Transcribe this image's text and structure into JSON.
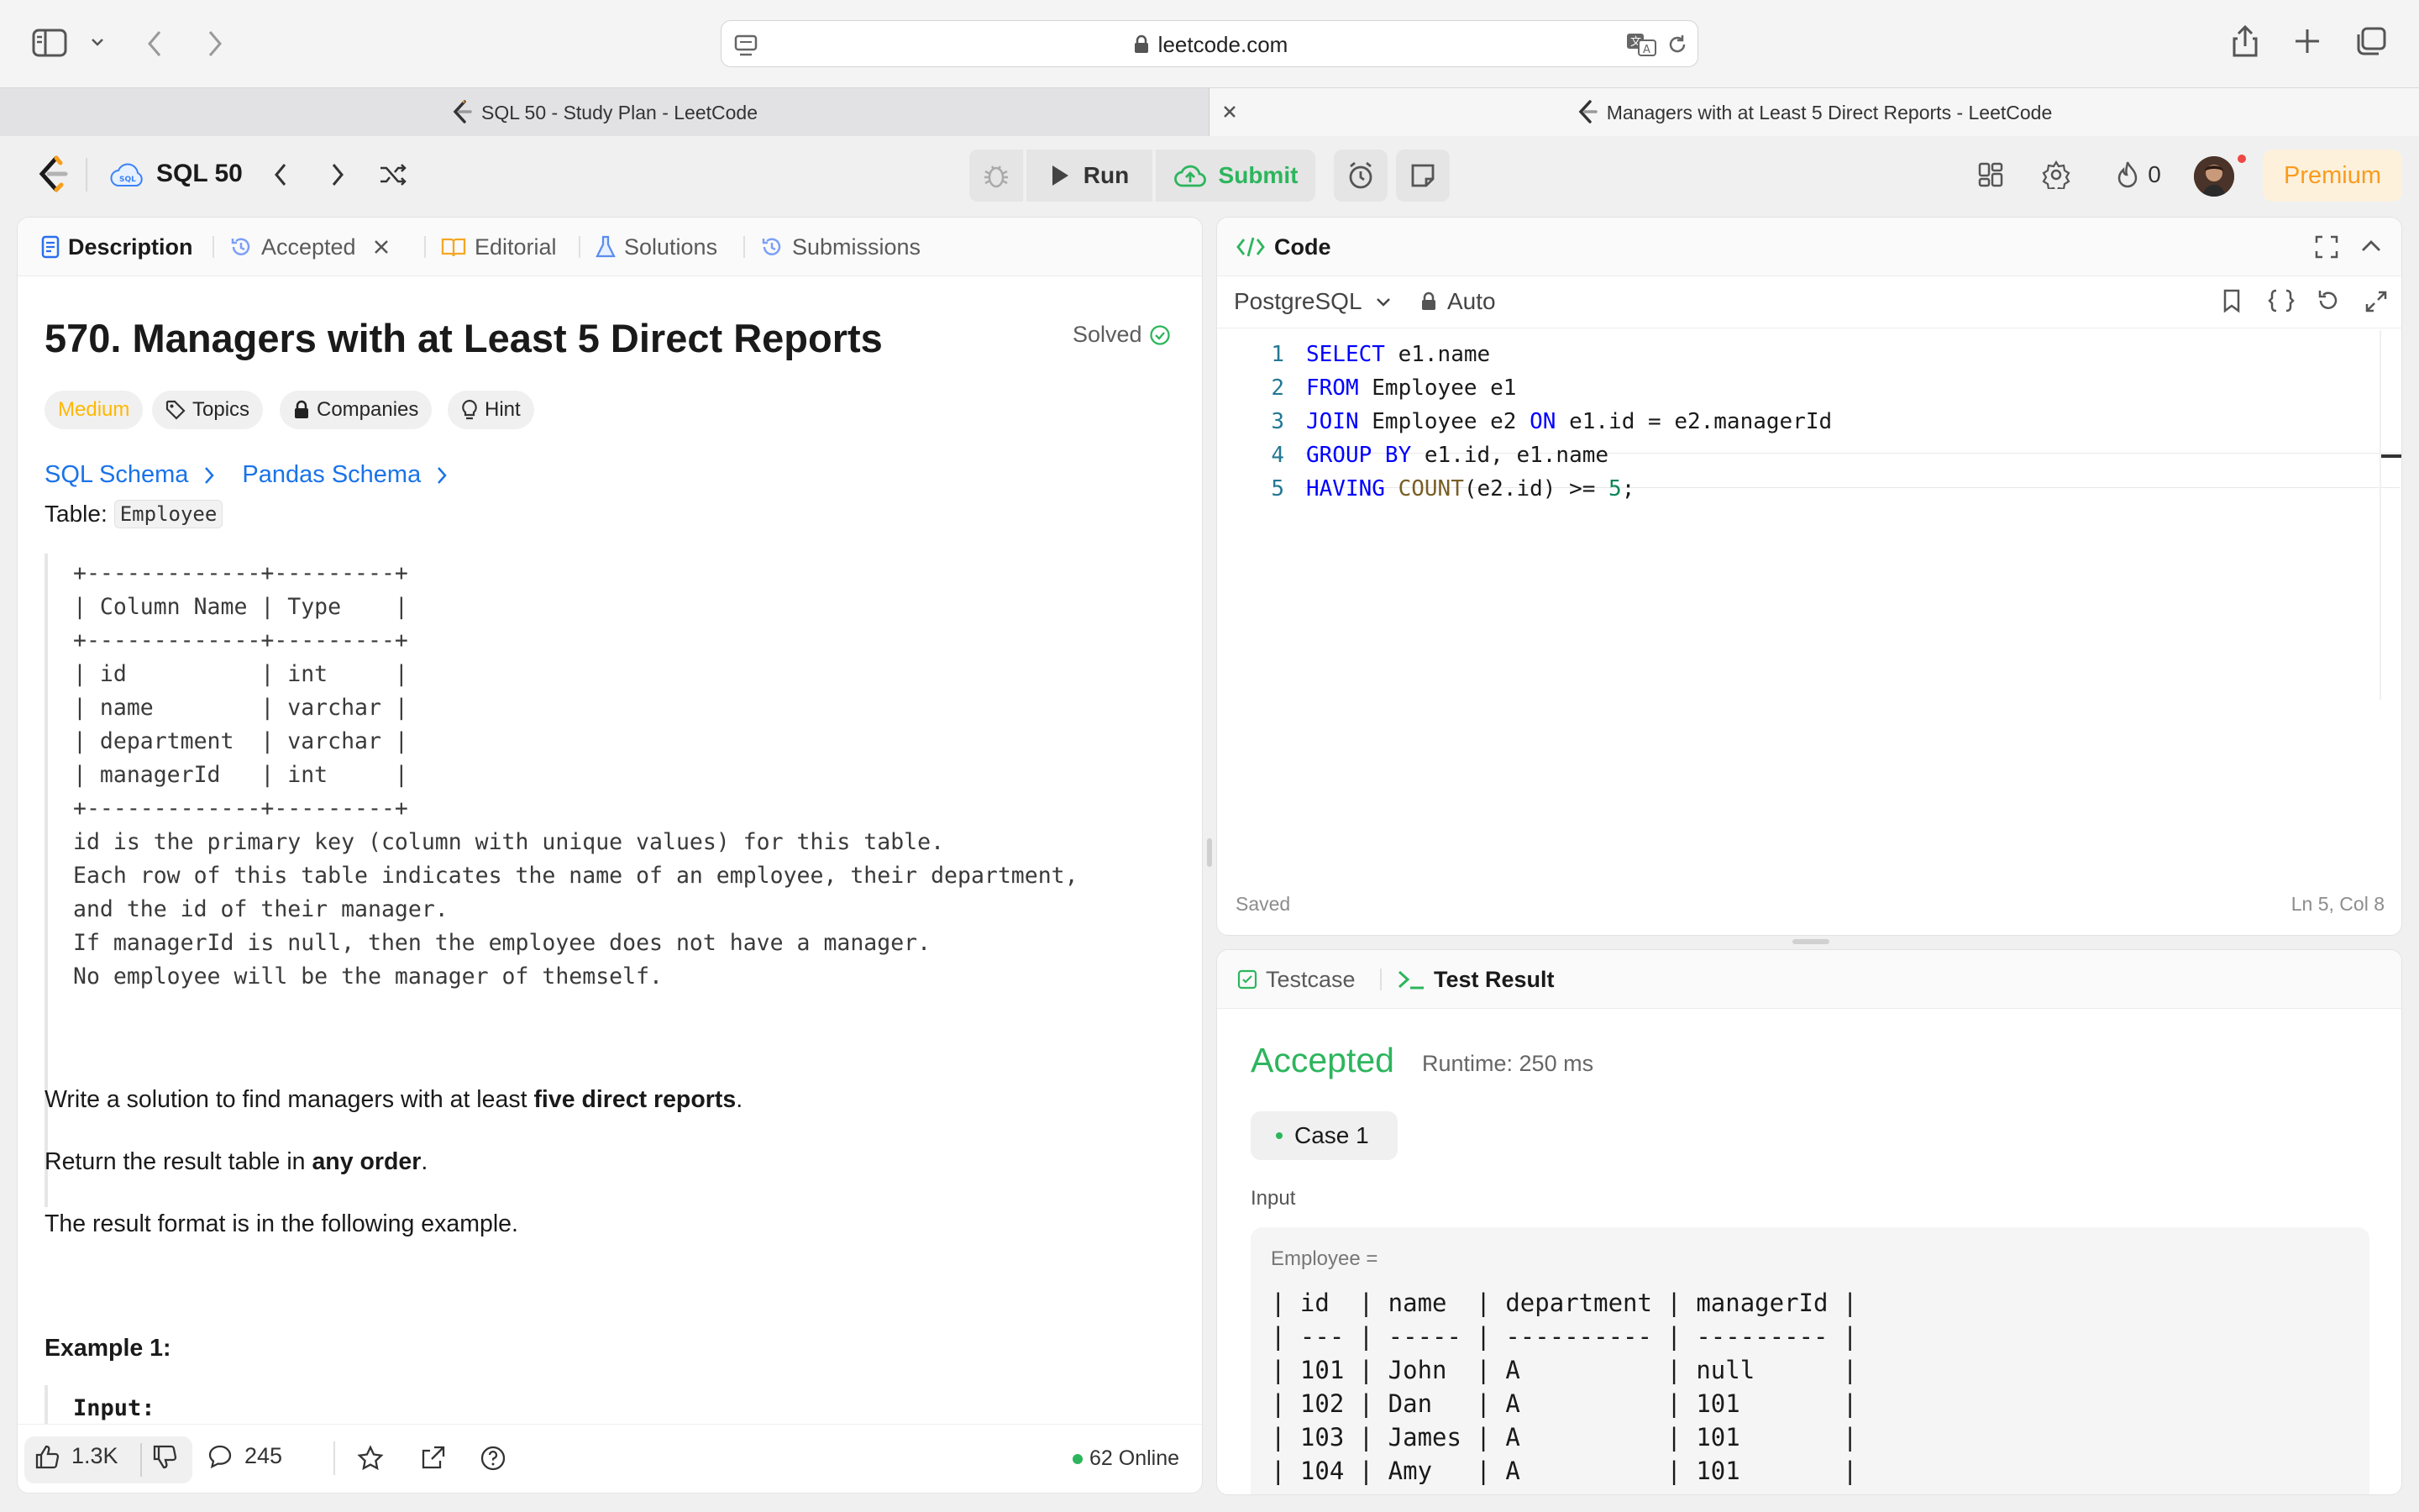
{
  "browser": {
    "url": "leetcode.com",
    "tabs": [
      {
        "title": "SQL 50 - Study Plan - LeetCode"
      },
      {
        "title": "Managers with at Least 5 Direct Reports - LeetCode"
      }
    ]
  },
  "appnav": {
    "study_plan": "SQL 50",
    "run_label": "Run",
    "submit_label": "Submit",
    "streak_count": "0",
    "premium_label": "Premium"
  },
  "left_tabs": {
    "description": "Description",
    "accepted": "Accepted",
    "editorial": "Editorial",
    "solutions": "Solutions",
    "submissions": "Submissions"
  },
  "problem": {
    "title": "570. Managers with at Least 5 Direct Reports",
    "solved": "Solved",
    "difficulty": "Medium",
    "topics": "Topics",
    "companies": "Companies",
    "hint": "Hint",
    "sql_schema": "SQL Schema",
    "pandas_schema": "Pandas Schema",
    "table_prefix": "Table:",
    "table_name": "Employee",
    "schema_block": "+-------------+---------+\n| Column Name | Type    |\n+-------------+---------+\n| id          | int     |\n| name        | varchar |\n| department  | varchar |\n| managerId   | int     |\n+-------------+---------+\nid is the primary key (column with unique values) for this table.\nEach row of this table indicates the name of an employee, their department,\nand the id of their manager.\nIf managerId is null, then the employee does not have a manager.\nNo employee will be the manager of themself.",
    "p1_a": "Write a solution to find managers with at least ",
    "p1_b": "five direct reports",
    "p1_c": ".",
    "p2_a": "Return the result table in ",
    "p2_b": "any order",
    "p2_c": ".",
    "p3": "The result format is in the following example.",
    "example_heading": "Example 1:",
    "input_label": "Input:"
  },
  "footer": {
    "likes": "1.3K",
    "comments": "245",
    "online": "62 Online"
  },
  "code": {
    "header": "Code",
    "language": "PostgreSQL",
    "mode": "Auto",
    "lines": [
      {
        "num": "1",
        "parts": [
          {
            "t": "SELECT",
            "c": "kw"
          },
          {
            "t": " e1.name",
            "c": ""
          }
        ]
      },
      {
        "num": "2",
        "parts": [
          {
            "t": "FROM",
            "c": "kw"
          },
          {
            "t": " Employee e1",
            "c": ""
          }
        ]
      },
      {
        "num": "3",
        "parts": [
          {
            "t": "JOIN",
            "c": "kw"
          },
          {
            "t": " Employee e2 ",
            "c": ""
          },
          {
            "t": "ON",
            "c": "kw"
          },
          {
            "t": " e1.id = e2.managerId",
            "c": ""
          }
        ]
      },
      {
        "num": "4",
        "parts": [
          {
            "t": "GROUP BY",
            "c": "kw"
          },
          {
            "t": " e1.id, e1.name",
            "c": ""
          }
        ]
      },
      {
        "num": "5",
        "parts": [
          {
            "t": "HAVING",
            "c": "kw"
          },
          {
            "t": " ",
            "c": ""
          },
          {
            "t": "COUNT",
            "c": "fn"
          },
          {
            "t": "(e2.id) >= ",
            "c": ""
          },
          {
            "t": "5",
            "c": "num"
          },
          {
            "t": ";",
            "c": ""
          }
        ]
      }
    ],
    "status_saved": "Saved",
    "cursor_pos": "Ln 5, Col 8"
  },
  "result": {
    "testcase_tab": "Testcase",
    "testresult_tab": "Test Result",
    "status": "Accepted",
    "runtime": "Runtime: 250 ms",
    "case_label": "Case 1",
    "input_label": "Input",
    "var_label": "Employee =",
    "table_text": "| id  | name  | department | managerId |\n| --- | ----- | ---------- | --------- |\n| 101 | John  | A          | null      |\n| 102 | Dan   | A          | 101       |\n| 103 | James | A          | 101       |\n| 104 | Amy   | A          | 101       |"
  },
  "colors": {
    "accent_green": "#2db55d",
    "medium_orange": "#ffb800",
    "premium_orange": "#fa9b1e",
    "link_blue": "#1a73e8"
  }
}
